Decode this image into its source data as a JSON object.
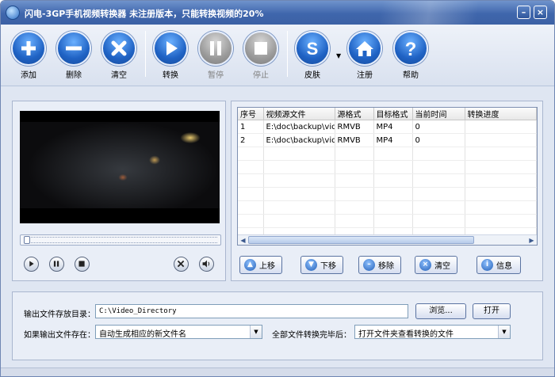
{
  "window": {
    "title": "闪电-3GP手机视频转换器  未注册版本，只能转换视频的20%"
  },
  "toolbar": {
    "buttons": [
      {
        "id": "add",
        "label": "添加",
        "icon": "plus-icon",
        "enabled": true
      },
      {
        "id": "delete",
        "label": "删除",
        "icon": "minus-icon",
        "enabled": true
      },
      {
        "id": "clear",
        "label": "清空",
        "icon": "x-icon",
        "enabled": true
      },
      {
        "id": "convert",
        "label": "转换",
        "icon": "play-icon",
        "enabled": true
      },
      {
        "id": "pause",
        "label": "暂停",
        "icon": "pause-icon",
        "enabled": false
      },
      {
        "id": "stop",
        "label": "停止",
        "icon": "stop-icon",
        "enabled": false
      },
      {
        "id": "skin",
        "label": "皮肤",
        "icon": "skin-s-icon",
        "enabled": true
      },
      {
        "id": "register",
        "label": "注册",
        "icon": "home-icon",
        "enabled": true
      },
      {
        "id": "help",
        "label": "帮助",
        "icon": "question-icon",
        "enabled": true
      }
    ]
  },
  "file_list": {
    "columns": [
      "序号",
      "视频源文件",
      "源格式",
      "目标格式",
      "当前时间",
      "转换进度"
    ],
    "rows": [
      [
        "1",
        "E:\\doc\\backup\\vid...",
        "RMVB",
        "MP4",
        "0",
        ""
      ],
      [
        "2",
        "E:\\doc\\backup\\vid...",
        "RMVB",
        "MP4",
        "0",
        ""
      ]
    ],
    "buttons": {
      "move_up": "上移",
      "move_down": "下移",
      "remove": "移除",
      "clear": "清空",
      "info": "信息"
    }
  },
  "output": {
    "dir_label": "输出文件存放目录：",
    "dir_value": "C:\\Video_Directory",
    "browse_label": "浏览...",
    "open_label": "打开",
    "exists_label": "如果输出文件存在：",
    "exists_value": "自动生成相应的新文件名",
    "after_label": "全部文件转换完毕后：",
    "after_value": "打开文件夹查看转换的文件"
  },
  "colors": {
    "accent": "#2460b7",
    "panel": "#e9eef7"
  }
}
